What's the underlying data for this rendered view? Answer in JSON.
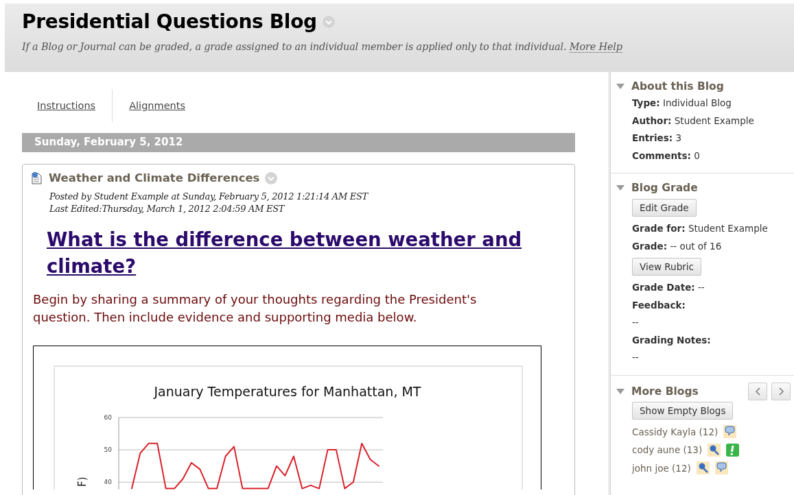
{
  "header": {
    "title": "Presidential Questions Blog",
    "help_text": "If a Blog or Journal can be graded, a grade assigned to an individual member is applied only to that individual.",
    "help_link": "More Help"
  },
  "tabs": [
    {
      "label": "Instructions"
    },
    {
      "label": "Alignments"
    }
  ],
  "date_bar": "Sunday, February 5, 2012",
  "entry": {
    "title": "Weather and Climate Differences",
    "posted": "Posted by Student Example at Sunday, February 5, 2012 1:21:14 AM EST",
    "edited": "Last Edited:Thursday, March 1, 2012 2:04:59 AM EST",
    "heading": "What is the difference between weather and climate?",
    "body": "Begin by sharing a summary of your thoughts regarding the President's question.  Then include evidence and supporting media below.",
    "chart_data": {
      "type": "line",
      "title": "January Temperatures for Manhattan, MT",
      "ylabel": "F)",
      "categories": [
        null,
        null,
        null,
        null,
        null,
        null,
        null,
        null,
        null,
        null,
        null,
        null,
        null,
        null,
        null,
        null,
        null,
        null,
        null,
        null,
        null,
        null,
        null,
        null,
        null,
        null,
        null,
        null,
        null,
        null
      ],
      "ylim": [
        37.5,
        60
      ],
      "yticks": [
        40,
        50,
        60
      ],
      "series": [
        {
          "color": "#d9202a",
          "values": [
            38,
            49,
            52,
            52,
            38,
            38,
            41,
            46,
            44,
            38,
            38,
            48,
            51,
            38,
            38,
            38,
            38,
            45,
            42,
            48,
            38,
            39,
            38,
            50,
            50,
            38,
            40,
            52,
            47,
            45
          ]
        }
      ]
    }
  },
  "sidebar": [
    {
      "kind": "info",
      "title": "About this Blog",
      "expanded": true,
      "items": [
        {
          "kind": "field",
          "label": "Type:",
          "value": "Individual Blog"
        },
        {
          "kind": "field",
          "label": "Author:",
          "value": "Student Example"
        },
        {
          "kind": "field",
          "label": "Entries:",
          "value": "3"
        },
        {
          "kind": "field",
          "label": "Comments:",
          "value": "0"
        }
      ]
    },
    {
      "kind": "info",
      "title": "Blog Grade",
      "expanded": true,
      "items": [
        {
          "kind": "button",
          "text": "Edit Grade"
        },
        {
          "kind": "field",
          "label": "Grade for:",
          "value": "Student Example"
        },
        {
          "kind": "field",
          "label": "Grade:",
          "value": "-- out of 16"
        },
        {
          "kind": "button",
          "text": "View Rubric"
        },
        {
          "kind": "field",
          "label": "Grade Date:",
          "value": "--"
        },
        {
          "kind": "block",
          "label": "Feedback:",
          "value": "--"
        },
        {
          "kind": "block",
          "label": "Grading Notes:",
          "value": "--"
        }
      ]
    },
    {
      "kind": "blogs",
      "title": "More Blogs",
      "expanded": true,
      "button": "Show Empty Blogs",
      "blogs": [
        {
          "name": "Cassidy Kayla (12)",
          "icons": [
            {
              "kind": "comment"
            }
          ]
        },
        {
          "name": "cody aune (13)",
          "icons": [
            {
              "kind": "pin"
            },
            {
              "kind": "alert"
            }
          ]
        },
        {
          "name": "john joe (12)",
          "icons": [
            {
              "kind": "pin"
            },
            {
              "kind": "comment"
            }
          ]
        }
      ]
    }
  ]
}
